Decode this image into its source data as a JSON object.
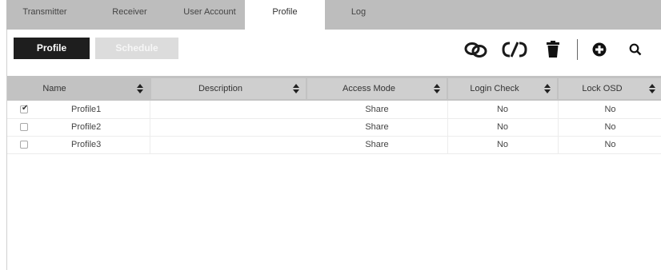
{
  "tabs": [
    {
      "label": "Transmitter",
      "active": false
    },
    {
      "label": "Receiver",
      "active": false
    },
    {
      "label": "User Account",
      "active": false
    },
    {
      "label": "Profile",
      "active": true
    },
    {
      "label": "Log",
      "active": false
    }
  ],
  "toolbar": {
    "profile_label": "Profile",
    "schedule_label": "Schedule",
    "icons": [
      "link-icon",
      "unlink-icon",
      "trash-icon",
      "add-icon",
      "search-icon"
    ]
  },
  "table": {
    "columns": [
      "Name",
      "Description",
      "Access Mode",
      "Login Check",
      "Lock OSD"
    ],
    "rows": [
      {
        "checked": true,
        "name": "Profile1",
        "description": "",
        "access_mode": "Share",
        "login_check": "No",
        "lock_osd": "No"
      },
      {
        "checked": false,
        "name": "Profile2",
        "description": "",
        "access_mode": "Share",
        "login_check": "No",
        "lock_osd": "No"
      },
      {
        "checked": false,
        "name": "Profile3",
        "description": "",
        "access_mode": "Share",
        "login_check": "No",
        "lock_osd": "No"
      }
    ]
  },
  "colors": {
    "tabbar_bg": "#bdbdbd",
    "primary_button": "#1e1e1e",
    "disabled_button": "#dcdcdc",
    "header_bg": "#cfcfcf"
  }
}
